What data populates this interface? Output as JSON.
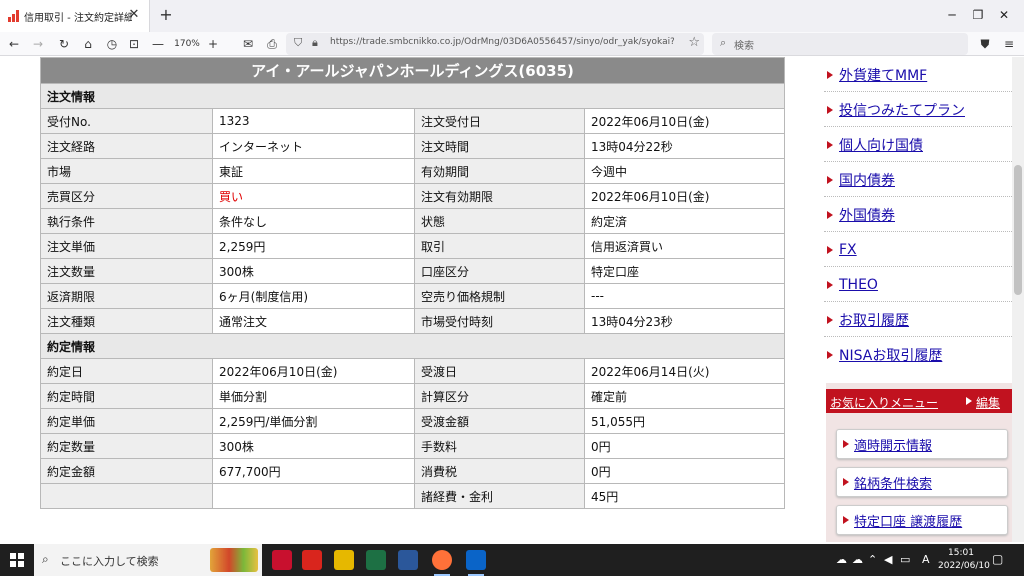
{
  "browser": {
    "tab_title": "信用取引 - 注文約定詳細 - | 日興",
    "tab_close": "✕",
    "new_tab": "+",
    "zoom": "170%",
    "zoom_out": "—",
    "zoom_in": "+",
    "url": "https://trade.smbcnikko.co.jp/OdrMng/03D6A0556457/sinyo/odr_yak/syokai?odrNo=",
    "search_placeholder": "検索"
  },
  "page": {
    "company_header": "アイ・アールジャパンホールディングス(6035)",
    "order_section": "注文情報",
    "order_rows": [
      {
        "l1": "受付No.",
        "v1": "1323",
        "l2": "注文受付日",
        "v2": "2022年06月10日(金)"
      },
      {
        "l1": "注文経路",
        "v1": "インターネット",
        "l2": "注文時間",
        "v2": "13時04分22秒"
      },
      {
        "l1": "市場",
        "v1": "東証",
        "l2": "有効期間",
        "v2": "今週中"
      },
      {
        "l1": "売買区分",
        "v1": "買い",
        "l2": "注文有効期限",
        "v2": "2022年06月10日(金)"
      },
      {
        "l1": "執行条件",
        "v1": "条件なし",
        "l2": "状態",
        "v2": "約定済"
      },
      {
        "l1": "注文単価",
        "v1": "2,259円",
        "l2": "取引",
        "v2": "信用返済買い"
      },
      {
        "l1": "注文数量",
        "v1": "300株",
        "l2": "口座区分",
        "v2": "特定口座"
      },
      {
        "l1": "返済期限",
        "v1": "6ヶ月(制度信用)",
        "l2": "空売り価格規制",
        "v2": "---"
      },
      {
        "l1": "注文種類",
        "v1": "通常注文",
        "l2": "市場受付時刻",
        "v2": "13時04分23秒"
      }
    ],
    "exec_section": "約定情報",
    "exec_rows": [
      {
        "l1": "約定日",
        "v1": "2022年06月10日(金)",
        "l2": "受渡日",
        "v2": "2022年06月14日(火)"
      },
      {
        "l1": "約定時間",
        "v1": "単価分割",
        "l2": "計算区分",
        "v2": "確定前"
      },
      {
        "l1": "約定単価",
        "v1": "2,259円/単価分割",
        "l2": "受渡金額",
        "v2": "51,055円"
      },
      {
        "l1": "約定数量",
        "v1": "300株",
        "l2": "手数料",
        "v2": "0円"
      },
      {
        "l1": "約定金額",
        "v1": "677,700円",
        "l2": "消費税",
        "v2": "0円"
      },
      {
        "l1": "",
        "v1": "",
        "l2": "諸経費・金利",
        "v2": "45円"
      }
    ]
  },
  "sidebar": {
    "items": [
      "外貨建てMMF",
      "投信つみたてプラン",
      "個人向け国債",
      "国内債券",
      "外国債券",
      "FX",
      "THEO",
      "お取引履歴",
      "NISAお取引履歴"
    ],
    "favorites_title": "お気に入りメニュー",
    "favorites_edit": "編集",
    "favorites": [
      "適時開示情報",
      "銘柄条件検索",
      "特定口座 譲渡履歴"
    ]
  },
  "taskbar": {
    "search_placeholder": "ここに入力して検索",
    "time": "15:01",
    "date": "2022/06/10",
    "ime": "A"
  },
  "colors": {
    "accent_red": "#c1121f",
    "header_gray": "#8a8a8a",
    "link_blue": "#1a0dab",
    "buy_red": "#e00000"
  }
}
